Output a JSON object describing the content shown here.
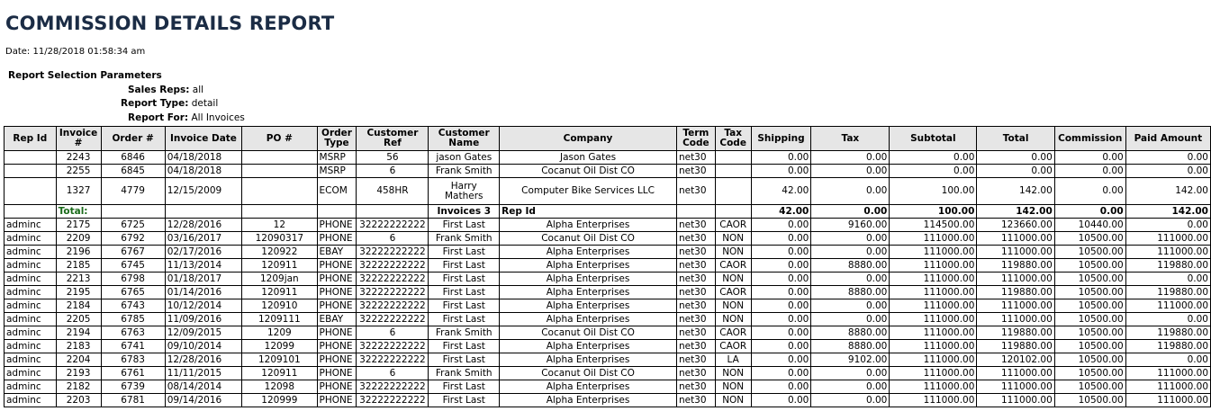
{
  "report": {
    "title": "COMMISSION DETAILS REPORT",
    "date_label": "Date:",
    "date_value": "11/28/2018 01:58:34 am",
    "params_title": "Report Selection Parameters",
    "sales_reps_label": "Sales Reps:",
    "sales_reps_value": "all",
    "report_type_label": "Report Type:",
    "report_type_value": "detail",
    "report_for_label": "Report For:",
    "report_for_value": "All Invoices"
  },
  "table": {
    "headers": [
      "Rep Id",
      "Invoice #",
      "Order #",
      "Invoice Date",
      "PO #",
      "Order Type",
      "Customer Ref",
      "Customer Name",
      "Company",
      "Term Code",
      "Tax Code",
      "Shipping",
      "Tax",
      "Subtotal",
      "Total",
      "Commission",
      "Paid Amount"
    ],
    "group1": [
      [
        "",
        "2243",
        "6846",
        "04/18/2018",
        "",
        "MSRP",
        "56",
        "jason Gates",
        "Jason Gates",
        "net30",
        "",
        "0.00",
        "0.00",
        "0.00",
        "0.00",
        "0.00",
        "0.00"
      ],
      [
        "",
        "2255",
        "6845",
        "04/18/2018",
        "",
        "MSRP",
        "6",
        "Frank Smith",
        "Cocanut Oil Dist CO",
        "net30",
        "",
        "0.00",
        "0.00",
        "0.00",
        "0.00",
        "0.00",
        "0.00"
      ],
      [
        "",
        "1327",
        "4779",
        "12/15/2009",
        "",
        "ECOM",
        "458HR",
        "Harry Mathers",
        "Computer Bike Services LLC",
        "net30",
        "",
        "42.00",
        "0.00",
        "100.00",
        "142.00",
        "0.00",
        "142.00"
      ]
    ],
    "total_row": [
      "",
      "Total:",
      "",
      "",
      "",
      "",
      "",
      "Invoices 3",
      "Rep Id",
      "",
      "",
      "42.00",
      "0.00",
      "100.00",
      "142.00",
      "0.00",
      "142.00"
    ],
    "group2": [
      [
        "adminc",
        "2175",
        "6725",
        "12/28/2016",
        "12",
        "PHONE",
        "32222222222",
        "First Last",
        "Alpha Enterprises",
        "net30",
        "CAOR",
        "0.00",
        "9160.00",
        "114500.00",
        "123660.00",
        "10440.00",
        "0.00"
      ],
      [
        "adminc",
        "2209",
        "6792",
        "03/16/2017",
        "12090317",
        "PHONE",
        "6",
        "Frank Smith",
        "Cocanut Oil Dist CO",
        "net30",
        "NON",
        "0.00",
        "0.00",
        "111000.00",
        "111000.00",
        "10500.00",
        "111000.00"
      ],
      [
        "adminc",
        "2196",
        "6767",
        "02/17/2016",
        "120922",
        "EBAY",
        "32222222222",
        "First Last",
        "Alpha Enterprises",
        "net30",
        "NON",
        "0.00",
        "0.00",
        "111000.00",
        "111000.00",
        "10500.00",
        "111000.00"
      ],
      [
        "adminc",
        "2185",
        "6745",
        "11/13/2014",
        "120911",
        "PHONE",
        "32222222222",
        "First Last",
        "Alpha Enterprises",
        "net30",
        "CAOR",
        "0.00",
        "8880.00",
        "111000.00",
        "119880.00",
        "10500.00",
        "119880.00"
      ],
      [
        "adminc",
        "2213",
        "6798",
        "01/18/2017",
        "1209jan",
        "PHONE",
        "32222222222",
        "First Last",
        "Alpha Enterprises",
        "net30",
        "NON",
        "0.00",
        "0.00",
        "111000.00",
        "111000.00",
        "10500.00",
        "0.00"
      ],
      [
        "adminc",
        "2195",
        "6765",
        "01/14/2016",
        "120911",
        "PHONE",
        "32222222222",
        "First Last",
        "Alpha Enterprises",
        "net30",
        "CAOR",
        "0.00",
        "8880.00",
        "111000.00",
        "119880.00",
        "10500.00",
        "119880.00"
      ],
      [
        "adminc",
        "2184",
        "6743",
        "10/12/2014",
        "120910",
        "PHONE",
        "32222222222",
        "First Last",
        "Alpha Enterprises",
        "net30",
        "NON",
        "0.00",
        "0.00",
        "111000.00",
        "111000.00",
        "10500.00",
        "111000.00"
      ],
      [
        "adminc",
        "2205",
        "6785",
        "11/09/2016",
        "1209111",
        "EBAY",
        "32222222222",
        "First Last",
        "Alpha Enterprises",
        "net30",
        "NON",
        "0.00",
        "0.00",
        "111000.00",
        "111000.00",
        "10500.00",
        "0.00"
      ],
      [
        "adminc",
        "2194",
        "6763",
        "12/09/2015",
        "1209",
        "PHONE",
        "6",
        "Frank Smith",
        "Cocanut Oil Dist CO",
        "net30",
        "CAOR",
        "0.00",
        "8880.00",
        "111000.00",
        "119880.00",
        "10500.00",
        "119880.00"
      ],
      [
        "adminc",
        "2183",
        "6741",
        "09/10/2014",
        "12099",
        "PHONE",
        "32222222222",
        "First Last",
        "Alpha Enterprises",
        "net30",
        "CAOR",
        "0.00",
        "8880.00",
        "111000.00",
        "119880.00",
        "10500.00",
        "119880.00"
      ],
      [
        "adminc",
        "2204",
        "6783",
        "12/28/2016",
        "1209101",
        "PHONE",
        "32222222222",
        "First Last",
        "Alpha Enterprises",
        "net30",
        "LA",
        "0.00",
        "9102.00",
        "111000.00",
        "120102.00",
        "10500.00",
        "0.00"
      ],
      [
        "adminc",
        "2193",
        "6761",
        "11/11/2015",
        "120911",
        "PHONE",
        "6",
        "Frank Smith",
        "Cocanut Oil Dist CO",
        "net30",
        "NON",
        "0.00",
        "0.00",
        "111000.00",
        "111000.00",
        "10500.00",
        "111000.00"
      ],
      [
        "adminc",
        "2182",
        "6739",
        "08/14/2014",
        "12098",
        "PHONE",
        "32222222222",
        "First Last",
        "Alpha Enterprises",
        "net30",
        "NON",
        "0.00",
        "0.00",
        "111000.00",
        "111000.00",
        "10500.00",
        "111000.00"
      ],
      [
        "adminc",
        "2203",
        "6781",
        "09/14/2016",
        "120999",
        "PHONE",
        "32222222222",
        "First Last",
        "Alpha Enterprises",
        "net30",
        "NON",
        "0.00",
        "0.00",
        "111000.00",
        "111000.00",
        "10500.00",
        "111000.00"
      ]
    ]
  }
}
